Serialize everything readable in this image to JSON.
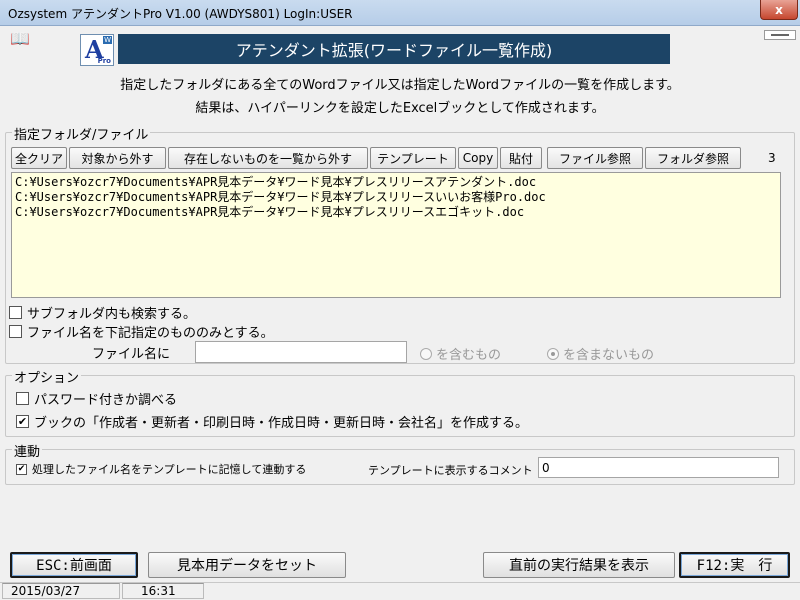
{
  "window": {
    "title": "Ozsystem アテンダントPro V1.00 (AWDYS801)  LogIn:USER",
    "close_label": "x"
  },
  "header": {
    "logo_letter": "A",
    "logo_badge": "W",
    "logo_sub": "Pro",
    "banner": "アテンダント拡張(ワードファイル一覧作成)",
    "description_line1": "指定したフォルダにある全てのWordファイル又は指定したWordファイルの一覧を作成します。",
    "description_line2": "結果は、ハイパーリンクを設定したExcelブックとして作成されます。"
  },
  "files_group": {
    "label": "指定フォルダ/ファイル",
    "toolbar": {
      "clear_all": "全クリア",
      "remove_selected": "対象から外す",
      "remove_missing": "存在しないものを一覧から外す",
      "template": "テンプレート",
      "copy": "Copy",
      "paste": "貼付",
      "browse_file": "ファイル参照",
      "browse_folder": "フォルダ参照"
    },
    "count": "3",
    "files": [
      "C:¥Users¥ozcr7¥Documents¥APR見本データ¥ワード見本¥プレスリリースアテンダント.doc",
      "C:¥Users¥ozcr7¥Documents¥APR見本データ¥ワード見本¥プレスリリースいいお客様Pro.doc",
      "C:¥Users¥ozcr7¥Documents¥APR見本データ¥ワード見本¥プレスリリースエゴキット.doc"
    ],
    "search_subfolders": {
      "label": "サブフォルダ内も検索する。",
      "checked": false
    },
    "filter_by_name": {
      "label": "ファイル名を下記指定のもののみとする。",
      "checked": false
    },
    "filename_label": "ファイル名に",
    "filename_value": "",
    "radio_contains": {
      "label": "を含むもの",
      "selected": false
    },
    "radio_not_contains": {
      "label": "を含まないもの",
      "selected": true
    }
  },
  "options_group": {
    "label": "オプション",
    "check_password": {
      "label": "パスワード付きか調べる",
      "checked": false
    },
    "create_properties": {
      "label": "ブックの「作成者・更新者・印刷日時・作成日時・更新日時・会社名」を作成する。",
      "checked": true
    }
  },
  "link_group": {
    "label": "連動",
    "remember_in_template": {
      "label": "処理したファイル名をテンプレートに記憶して連動する",
      "checked": true
    },
    "comment_label": "テンプレートに表示するコメント",
    "comment_value": "0"
  },
  "bottom": {
    "back_button": "ESC:前画面",
    "sample_button": "見本用データをセット",
    "prev_result_button": "直前の実行結果を表示",
    "run_button": "F12:実　行"
  },
  "status": {
    "date": "2015/03/27",
    "time": "16:31"
  },
  "colors": {
    "banner_bg": "#1c4466",
    "list_bg": "#ffffe0"
  }
}
